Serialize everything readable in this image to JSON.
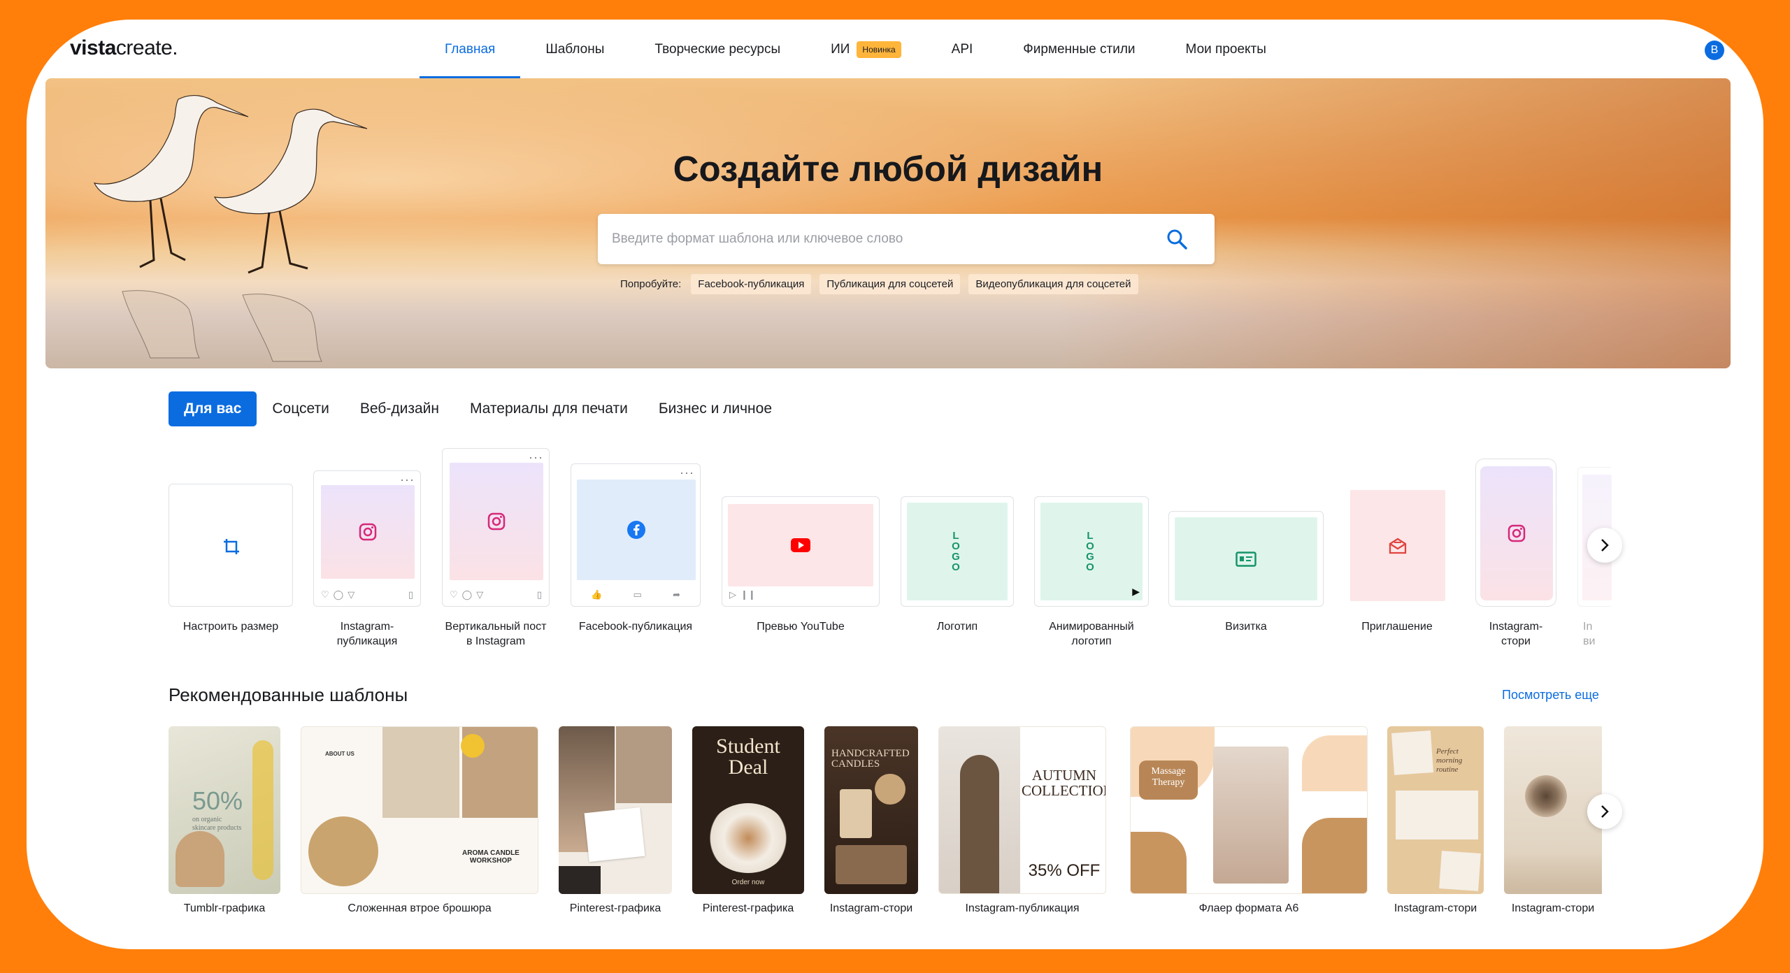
{
  "header": {
    "logo": {
      "bold": "vista",
      "light": "create."
    },
    "nav": [
      {
        "label": "Главная"
      },
      {
        "label": "Шаблоны"
      },
      {
        "label": "Творческие ресурсы"
      },
      {
        "label": "ИИ",
        "badge": "Новинка"
      },
      {
        "label": "API"
      },
      {
        "label": "Фирменные стили"
      },
      {
        "label": "Мои проекты"
      }
    ],
    "avatar": "В"
  },
  "hero": {
    "title": "Создайте любой дизайн",
    "search_placeholder": "Введите формат шаблона или ключевое слово",
    "try_label": "Попробуйте:",
    "suggestions": [
      "Facebook-публикация",
      "Публикация для соцсетей",
      "Видеопубликация для соцсетей"
    ]
  },
  "tabs": [
    "Для вас",
    "Соцсети",
    "Веб-дизайн",
    "Материалы для печати",
    "Бизнес и личное"
  ],
  "formats": [
    {
      "label": "Настроить размер",
      "icon": "crop-icon"
    },
    {
      "label": "Instagram-\nпубликация",
      "icon": "instagram-icon"
    },
    {
      "label": "Вертикальный пост\nв Instagram",
      "icon": "instagram-icon"
    },
    {
      "label": "Facebook-публикация",
      "icon": "facebook-icon"
    },
    {
      "label": "Превью YouTube",
      "icon": "youtube-icon"
    },
    {
      "label": "Логотип",
      "icon": "logo-icon",
      "logo_text": "LOGO"
    },
    {
      "label": "Анимированный\nлоготип",
      "icon": "logo-icon",
      "logo_text": "LOGO"
    },
    {
      "label": "Визитка",
      "icon": "id-card-icon"
    },
    {
      "label": "Приглашение",
      "icon": "envelope-icon"
    },
    {
      "label": "Instagram-\nстори",
      "icon": "instagram-icon"
    },
    {
      "label": "In\nви",
      "icon": "instagram-icon"
    }
  ],
  "recommended": {
    "title": "Рекомендованные шаблоны",
    "see_more": "Посмотреть еще",
    "items": [
      {
        "label": "Tumblr-графика",
        "art_text": "50%",
        "art_sub": "on organic\nskincare products"
      },
      {
        "label": "Сложенная втрое брошюра",
        "art_text": "AROMA CANDLE\nWORKSHOP",
        "art_sub": "ABOUT US"
      },
      {
        "label": "Pinterest-графика",
        "art_text": ""
      },
      {
        "label": "Pinterest-графика",
        "art_text": "Student\nDeal",
        "art_sub": "Order now"
      },
      {
        "label": "Instagram-стори",
        "art_text": "HANDCRAFTED\nCANDLES"
      },
      {
        "label": "Instagram-публикация",
        "art_text": "AUTUMN\nCOLLECTION",
        "art_sub": "35% OFF"
      },
      {
        "label": "Флаер формата А6",
        "art_text": "Massage\nTherapy"
      },
      {
        "label": "Instagram-стори",
        "art_text": "Perfect\nmorning\nroutine"
      },
      {
        "label": "Instagram-стори",
        "art_text": ""
      }
    ]
  },
  "colors": {
    "accent": "#0b6ce0",
    "frame": "#ff7f0a",
    "badge": "#ffb43a"
  }
}
